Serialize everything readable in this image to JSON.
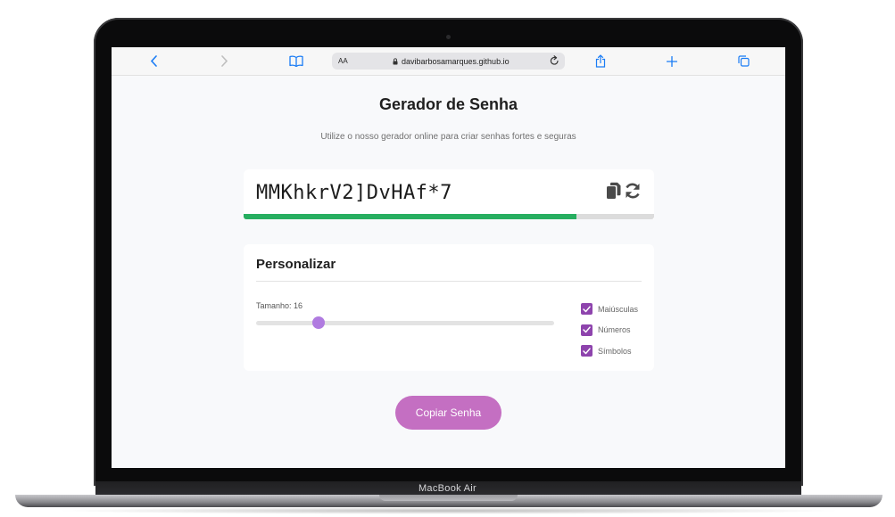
{
  "device": {
    "model_label": "MacBook Air"
  },
  "browser": {
    "url_text_size_label": "AA",
    "address": "davibarbosamarques.github.io",
    "icons": [
      "chevron-left-icon",
      "chevron-right-icon",
      "book-icon",
      "lock-icon",
      "reload-icon",
      "share-icon",
      "plus-icon",
      "tabs-icon"
    ],
    "accent_color": "#1a7cf5"
  },
  "page": {
    "title": "Gerador de Senha",
    "subtitle": "Utilize o nosso gerador online para criar senhas fortes e seguras"
  },
  "password": {
    "value": "MMKhkrV2]DvHAf*7",
    "strength_fraction": 0.81,
    "strength_color": "#27ae60",
    "icons": [
      "copy-icon",
      "refresh-icon"
    ]
  },
  "customize": {
    "title": "Personalizar",
    "size_label": "Tamanho: 16",
    "size_value": 16,
    "slider_fraction": 0.21,
    "options": [
      {
        "label": "Maiúsculas",
        "checked": true
      },
      {
        "label": "Números",
        "checked": true
      },
      {
        "label": "Símbolos",
        "checked": true
      }
    ],
    "accent_color": "#8e44ad"
  },
  "copy_button": {
    "label": "Copiar Senha",
    "color": "#c46fc2"
  }
}
